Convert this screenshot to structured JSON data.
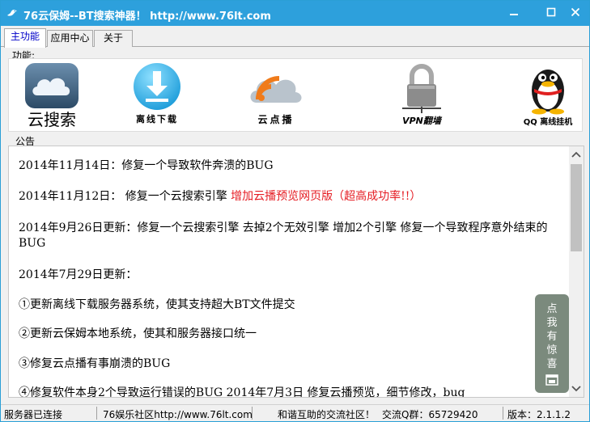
{
  "window": {
    "title": "76云保姆--BT搜索神器！  http://www.76lt.com",
    "icons": {
      "app": "bird-icon",
      "minimize": "minimize-icon",
      "maximize": "maximize-icon",
      "close": "close-icon"
    }
  },
  "tabs": [
    {
      "label": "主功能",
      "active": true
    },
    {
      "label": "应用中心",
      "active": false
    },
    {
      "label": "关于",
      "active": false
    }
  ],
  "features": {
    "section_label": "功能:",
    "items": [
      {
        "label": "云搜索",
        "icon": "cloud-icon"
      },
      {
        "label": "离线下载",
        "icon": "download-icon"
      },
      {
        "label": "云点播",
        "icon": "rss-cloud-icon"
      },
      {
        "label": "VPN翻墙",
        "icon": "padlock-icon"
      },
      {
        "label": "QQ 离线挂机",
        "icon": "penguin-icon"
      }
    ]
  },
  "notice": {
    "section_label": "公告",
    "lines": [
      {
        "text": "2014年11月14日：修复一个导致软件奔溃的BUG"
      },
      {
        "text": "2014年11月12日：  修复一个云搜索引擎  ",
        "highlight": "增加云播预览网页版（超高成功率!!）"
      },
      {
        "text": "2014年9月26日更新：修复一个云搜索引擎  去掉2个无效引擎  增加2个引擎  修复一个导致程序意外结束的BUG"
      },
      {
        "text": "2014年7月29日更新："
      },
      {
        "text": "①更新离线下载服务器系统，使其支持超大BT文件提交"
      },
      {
        "text": "②更新云保姆本地系统，使其和服务器接口统一"
      },
      {
        "text": "③修复云点播有事崩溃的BUG"
      },
      {
        "text": "④修复软件本身2个导致运行错误的BUG 2014年7月3日  修复云播预览，细节修改，bug"
      }
    ]
  },
  "surprise_button": {
    "label": "点我有惊喜",
    "icon": "window-icon"
  },
  "statusbar": {
    "status": "服务器已连接",
    "community": "76娱乐社区http://www.76lt.com",
    "slogan": "和谐互助的交流社区！",
    "qq_group": "交流Q群：65729420",
    "version": "版本：2.1.1.2"
  },
  "colors": {
    "titlebar": "#2da0dc",
    "highlight": "#e51c23",
    "active_tab_text": "#0000c8",
    "surprise_button": "#7b8a7d"
  }
}
